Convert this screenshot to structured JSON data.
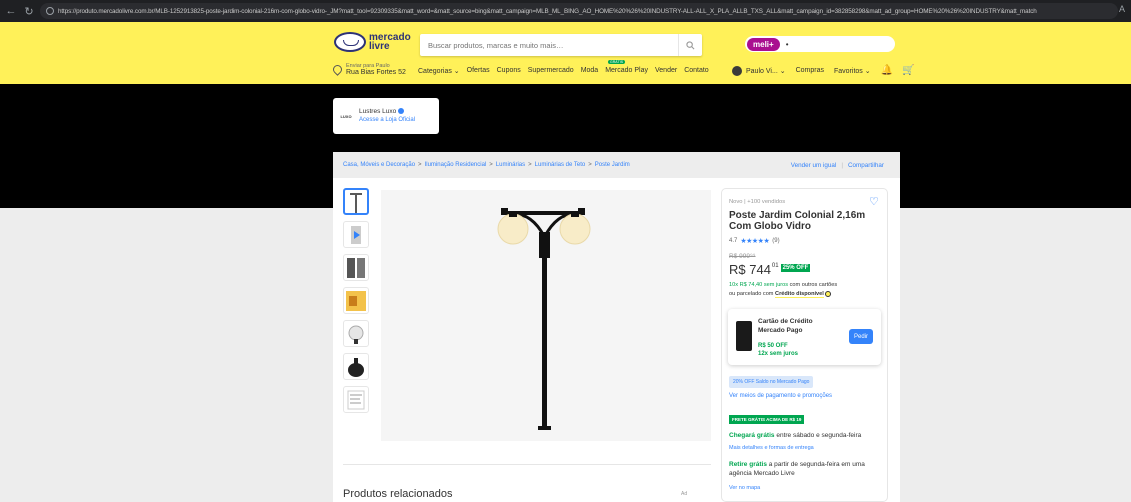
{
  "browser": {
    "back": "←",
    "reload": "↻",
    "url": "https://produto.mercadolivre.com.br/MLB-1252913825-poste-jardim-colonial-216m-com-globo-vidro-_JM?matt_tool=92309335&matt_word=&matt_source=bing&matt_campaign=MLB_ML_BING_AO_HOME%20%26%20INDUSTRY-ALL-ALL_X_PLA_ALLB_TXS_ALL&matt_campaign_id=382858298&matt_ad_group=HOME%20%26%20INDUSTRY&matt_match"
  },
  "header": {
    "logo_line1": "mercado",
    "logo_line2": "livre",
    "search_placeholder": "Buscar produtos, marcas e muito mais…",
    "promo_label": "meli+",
    "location_small": "Enviar para Paulo",
    "location_big": "Rua Bias Fortes 52",
    "menu": [
      "Categorias ⌄",
      "Ofertas",
      "Cupons",
      "Supermercado",
      "Moda",
      "Mercado Play",
      "Vender",
      "Contato"
    ],
    "new_badge": "GRÁTIS",
    "user": "Paulo Vi... ⌄",
    "purchases": "Compras",
    "favorites": "Favoritos ⌄"
  },
  "store": {
    "logo_text": "LUXO",
    "name": "Lustres Luxo",
    "link": "Acesse a Loja Oficial"
  },
  "breadcrumb": {
    "items": [
      "Casa, Móveis e Decoração",
      "Iluminação Residencial",
      "Luminárias",
      "Luminárias de Teto",
      "Poste Jardim"
    ],
    "sep": ">",
    "sell_same": "Vender um igual",
    "share": "Compartilhar"
  },
  "product": {
    "condition": "Novo  |  +100 vendidos",
    "title": "Poste Jardim Colonial 2,16m Com Globo Vidro",
    "rating": "4.7",
    "stars": "★★★★★",
    "reviews": "(9)",
    "old_price": "R$ 999⁹⁹",
    "price": "R$ 744",
    "price_cents": "01",
    "discount": "25% OFF",
    "installments_green": "10x R$ 74,40 sem juros",
    "installments_rest": " com outros cartões",
    "installments_line2": "ou parcelado com ",
    "credit": "Crédito disponível"
  },
  "card": {
    "title": "Cartão de Crédito Mercado Pago",
    "discount": "R$ 50 OFF",
    "installments": "12x sem juros",
    "button": "Pedir"
  },
  "payments": {
    "saldo": "20% OFF Saldo no Mercado Pago",
    "see_methods": "Ver meios de pagamento e promoções"
  },
  "shipping": {
    "free_badge": "FRETE GRÁTIS ACIMA DE R$ 19",
    "arrive_bold": "Chegará grátis",
    "arrive_rest": " entre sábado e segunda-feira",
    "arrive_link": "Mais detalhes e formas de entrega",
    "pickup_bold": "Retire grátis",
    "pickup_rest": " a partir de segunda-feira em uma agência Mercado Livre",
    "pickup_link": "Ver no mapa"
  },
  "related": {
    "title": "Produtos relacionados",
    "ad": "Ad"
  },
  "colors": {
    "yellow": "#fff159",
    "blue": "#3483fa",
    "green": "#00a650"
  }
}
